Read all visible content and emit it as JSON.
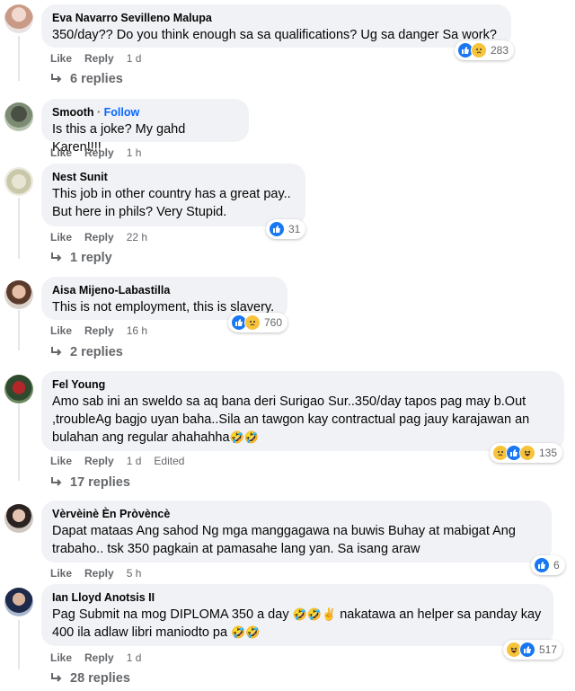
{
  "labels": {
    "like": "Like",
    "reply": "Reply"
  },
  "comments": [
    {
      "author": "Eva Navarro Sevilleno Malupa",
      "lines": [
        "350/day?? Do you think enough sa sa qualifications? Ug sa danger Sa work?"
      ],
      "time": "1 d",
      "reactions": [
        "like-icon",
        "sad-icon"
      ],
      "reaction_count": "283",
      "replies": "6 replies"
    },
    {
      "author": "Smooth",
      "follow": "Follow",
      "lines": [
        "Is this a joke? My gahd Karen!!!!"
      ],
      "time": "1 h"
    },
    {
      "author": "Nest Sunit",
      "lines": [
        "This job in other country has a great pay..",
        "But here in phils? Very Stupid."
      ],
      "time": "22 h",
      "reactions": [
        "like-icon"
      ],
      "reaction_count": "31",
      "replies": "1 reply"
    },
    {
      "author": "Aisa Mijeno-Labastilla",
      "lines": [
        "This is not employment, this is slavery."
      ],
      "time": "16 h",
      "reactions": [
        "like-icon",
        "sad-icon"
      ],
      "reaction_count": "760",
      "replies": "2 replies"
    },
    {
      "author": "Fel Young",
      "lines": [
        "Amo sab ini an sweldo sa aq bana deri Surigao Sur..350/day tapos pag may b.Out",
        ",troubleAg bagjo uyan baha..Sila an tawgon kay contractual pag jauy karajawan an",
        "bulahan ang regular ahahahha"
      ],
      "time": "1 d",
      "edited": "Edited",
      "reactions": [
        "sad-icon",
        "like-icon",
        "haha-icon"
      ],
      "reaction_count": "135",
      "replies": "17 replies"
    },
    {
      "author": "Vèrvèinè Èn Pròvèncè",
      "lines": [
        "Dapat mataas Ang sahod Ng mga manggagawa na buwis Buhay at mabigat Ang",
        "trabaho.. tsk 350 pagkain at pamasahe lang yan. Sa isang araw"
      ],
      "time": "5 h",
      "reactions": [
        "like-icon"
      ],
      "reaction_count": "6"
    },
    {
      "author": "Ian Lloyd Anotsis II",
      "lines": [
        "Pag Submit na mog DIPLOMA 350 a day",
        "400 ila adlaw libri maniodto pa"
      ],
      "inline_text": "nakatawa an helper sa panday kay",
      "time": "1 d",
      "reactions": [
        "haha-icon",
        "like-icon"
      ],
      "reaction_count": "517",
      "replies": "28 replies"
    }
  ]
}
